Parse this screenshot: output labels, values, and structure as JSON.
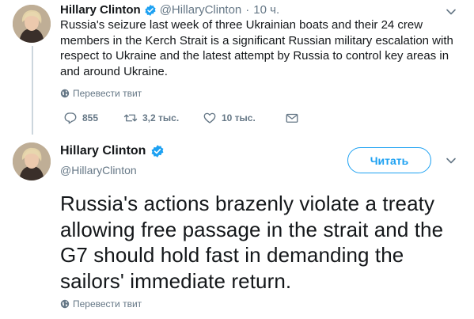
{
  "tweet_quoted": {
    "name": "Hillary Clinton",
    "handle": "@HillaryClinton",
    "separator": "·",
    "time": "10 ч.",
    "text": "Russia's seizure last week of three Ukrainian boats and their 24 crew members in the Kerch Strait is a significant Russian military escalation with respect to Ukraine and the latest attempt by Russia to control key areas in and around Ukraine.",
    "translate_label": "Перевести твит",
    "replies": "855",
    "retweets": "3,2 тыс.",
    "likes": "10 тыс."
  },
  "tweet_main": {
    "name": "Hillary Clinton",
    "handle": "@HillaryClinton",
    "follow_label": "Читать",
    "text": "Russia's actions brazenly violate a treaty allowing free passage in the strait and the G7 should hold fast in demanding the sailors' immediate return.",
    "translate_label": "Перевести твит"
  },
  "colors": {
    "accent": "#1da1f2",
    "secondary_text": "#657786",
    "thread_line": "#ccd6dd"
  },
  "icons": [
    "verified-badge-icon",
    "chevron-down-icon",
    "globe-icon",
    "reply-icon",
    "retweet-icon",
    "like-icon",
    "direct-message-icon"
  ]
}
